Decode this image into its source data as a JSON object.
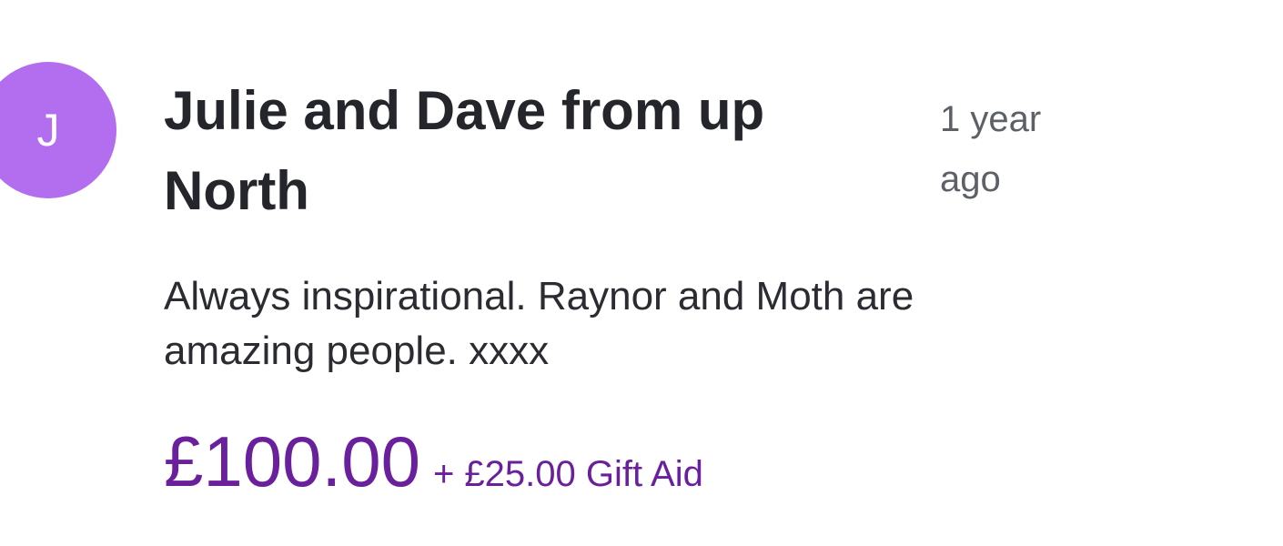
{
  "donation": {
    "avatar_initial": "J",
    "donor_name": "Julie and Dave from up North",
    "timestamp": "1 year ago",
    "message": "Always inspirational. Raynor and Moth are amazing people. xxxx",
    "amount": "£100.00",
    "gift_aid": "+ £25.00 Gift Aid"
  },
  "colors": {
    "avatar_background": "#b36ef0",
    "amount_text": "#6a1f9c"
  }
}
